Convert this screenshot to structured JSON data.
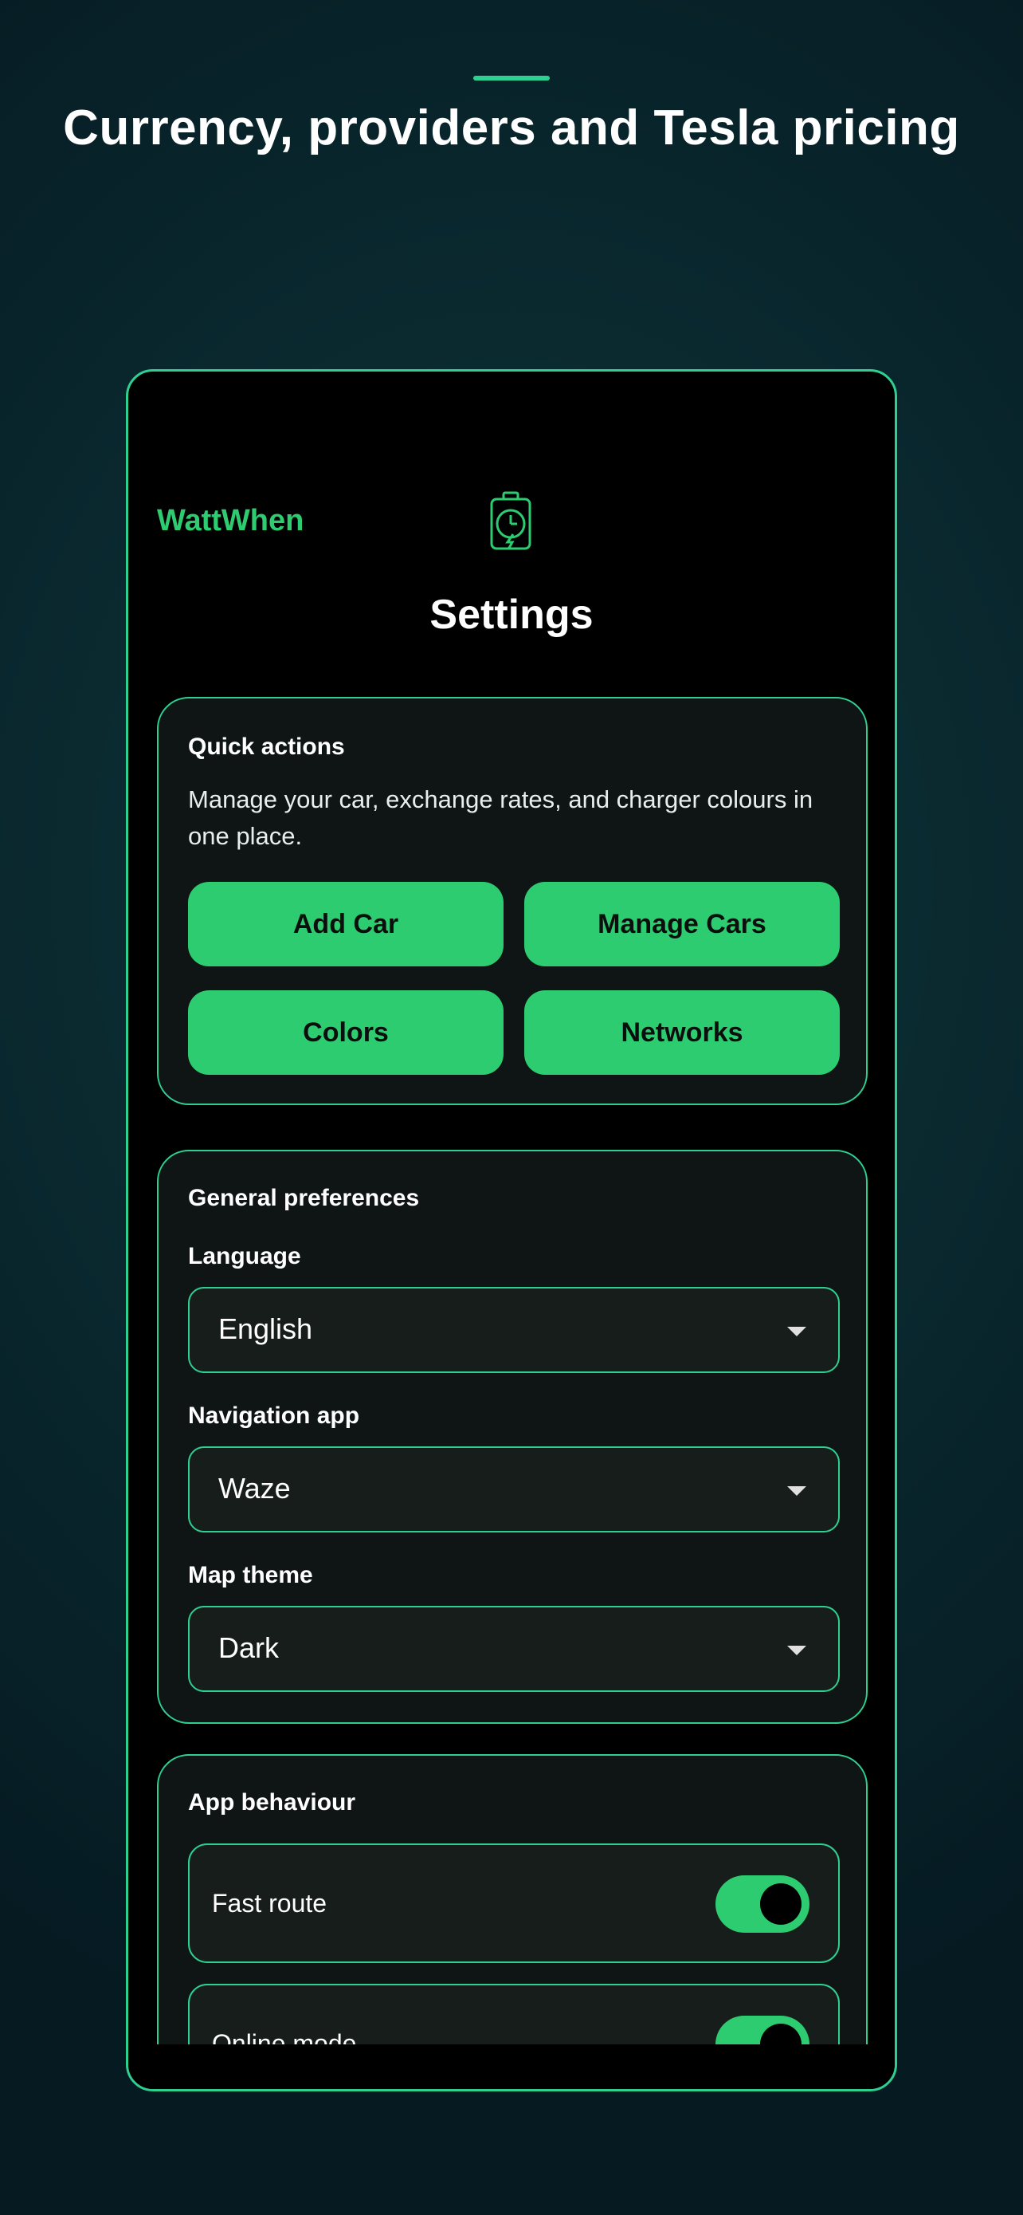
{
  "headline": "Currency, providers and Tesla pricing",
  "colors": {
    "accent": "#2ecc71",
    "outline": "#2ed091",
    "card": "#0f1514"
  },
  "app": {
    "name": "WattWhen",
    "logo_icon": "battery-clock-icon",
    "screen_title": "Settings"
  },
  "quick_actions": {
    "title": "Quick actions",
    "description": "Manage your car, exchange rates, and charger colours in one place.",
    "buttons": [
      "Add Car",
      "Manage Cars",
      "Colors",
      "Networks"
    ]
  },
  "general": {
    "title": "General preferences",
    "language": {
      "label": "Language",
      "value": "English"
    },
    "navigation_app": {
      "label": "Navigation app",
      "value": "Waze"
    },
    "map_theme": {
      "label": "Map theme",
      "value": "Dark"
    }
  },
  "behaviour": {
    "title": "App behaviour",
    "toggles": [
      {
        "label": "Fast route",
        "on": true
      },
      {
        "label": "Online mode",
        "on": true
      }
    ]
  }
}
